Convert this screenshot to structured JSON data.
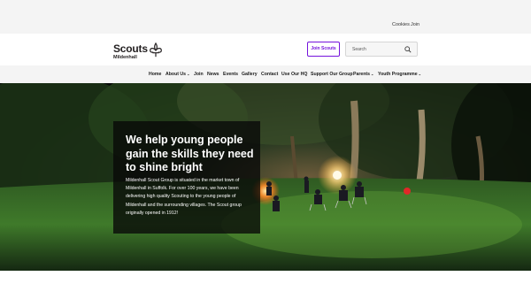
{
  "utility": {
    "cookies": "Cookies",
    "join": "Join"
  },
  "logo": {
    "name": "Scouts",
    "group": "Mildenhall",
    "icon": "fleur-de-lis-icon"
  },
  "header": {
    "join_button": "Join Scouts",
    "search_placeholder": "Search"
  },
  "nav": [
    {
      "label": "Home",
      "has_menu": false
    },
    {
      "label": "About Us",
      "has_menu": true
    },
    {
      "label": "Join",
      "has_menu": false
    },
    {
      "label": "News",
      "has_menu": false
    },
    {
      "label": "Events",
      "has_menu": false
    },
    {
      "label": "Gallery",
      "has_menu": false
    },
    {
      "label": "Contact",
      "has_menu": false
    },
    {
      "label": "Use Our HQ",
      "has_menu": false
    },
    {
      "label": "Support Our Group",
      "has_menu": false
    },
    {
      "label": "Parents",
      "has_menu": true
    },
    {
      "label": "Youth Programme",
      "has_menu": true
    }
  ],
  "hero": {
    "heading": "We help young people gain the skills they need to shine bright",
    "body": "Mildenhall Scout Group is situated in the market town of Mildenhall in Suffolk. For over 100 years, we have been delivering high quality Scouting to the young people of Mildenhall and the surrounding villages. The Scout group originally opened in 1912!"
  },
  "colors": {
    "brand_purple": "#7413dc",
    "nav_bg": "#f4f4f4"
  }
}
